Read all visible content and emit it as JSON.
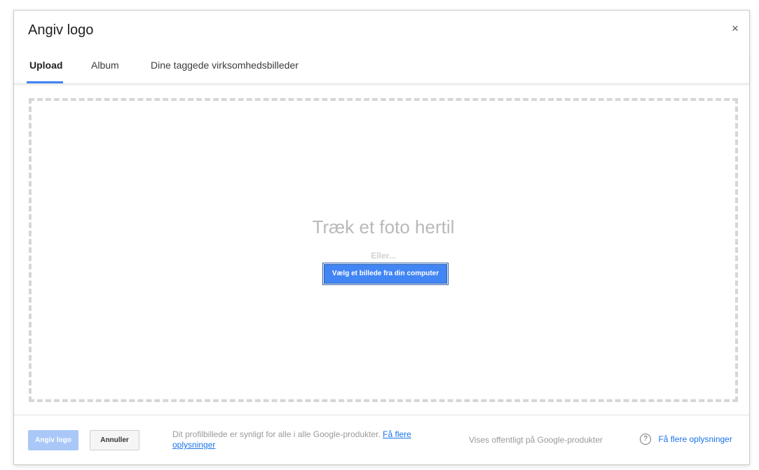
{
  "dialog": {
    "title": "Angiv logo",
    "close_label": "×"
  },
  "tabs": [
    {
      "label": "Upload",
      "active": true
    },
    {
      "label": "Album",
      "active": false
    },
    {
      "label": "Dine taggede virksomhedsbilleder",
      "active": false
    }
  ],
  "dropzone": {
    "drop_text": "Træk et foto hertil",
    "or_text": "Eller...",
    "choose_button": "Vælg et billede fra din computer"
  },
  "footer": {
    "confirm_button": "Angiv logo",
    "cancel_button": "Annuller",
    "note_text": "Dit profilbillede er synligt for alle i alle Google-produkter.",
    "note_link": "Få flere oplysninger",
    "public_text": "Vises offentligt på Google-produkter",
    "help_icon": "?",
    "help_link": "Få flere oplysninger"
  },
  "colors": {
    "accent": "#4285f4",
    "accent_disabled": "#a9c8f8",
    "link": "#1a73e8"
  }
}
